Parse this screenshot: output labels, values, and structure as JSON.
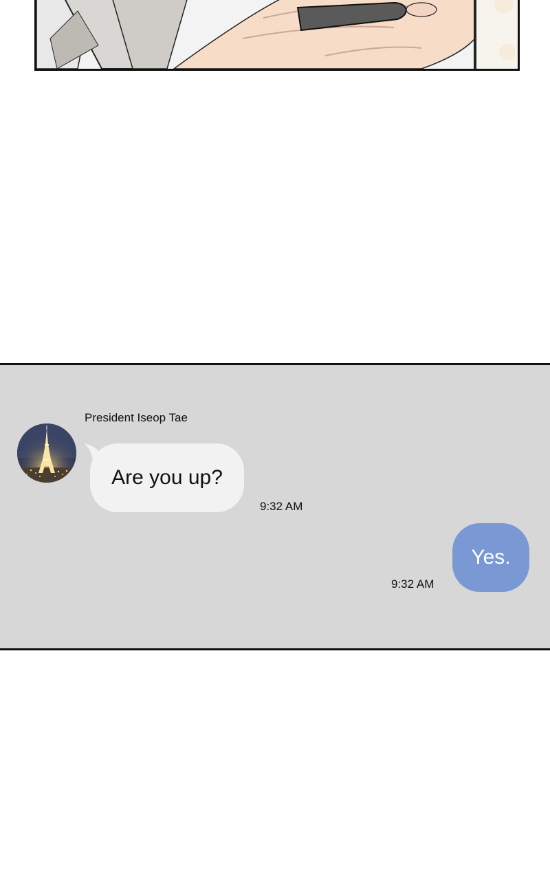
{
  "chat": {
    "contact_name": "President Iseop Tae",
    "messages": [
      {
        "direction": "incoming",
        "text": "Are you up?",
        "time": "9:32 AM"
      },
      {
        "direction": "outgoing",
        "text": "Yes.",
        "time": "9:32 AM"
      }
    ],
    "avatar": {
      "icon": "eiffel-tower-night-icon"
    }
  },
  "colors": {
    "chat_background": "#d7d7d7",
    "incoming_bubble": "#f2f2f2",
    "outgoing_bubble": "#7a98d4",
    "panel_border": "#111111"
  }
}
